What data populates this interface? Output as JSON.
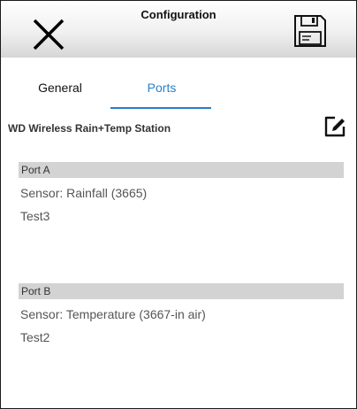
{
  "header": {
    "title": "Configuration",
    "close_icon": "close-icon",
    "save_icon": "floppy-disk-save-icon"
  },
  "tabs": [
    {
      "label": "General",
      "selected": false
    },
    {
      "label": "Ports",
      "selected": true
    }
  ],
  "device": {
    "name": "WD Wireless Rain+Temp Station",
    "edit_icon": "edit-pencil-icon"
  },
  "ports": [
    {
      "header": "Port A",
      "sensor": "Sensor: Rainfall (3665)",
      "name": "Test3"
    },
    {
      "header": "Port B",
      "sensor": "Sensor: Temperature (3667-in air)",
      "name": "Test2"
    }
  ],
  "colors": {
    "accent": "#2a7fc6",
    "port_header_bg": "#d3d3d3"
  }
}
